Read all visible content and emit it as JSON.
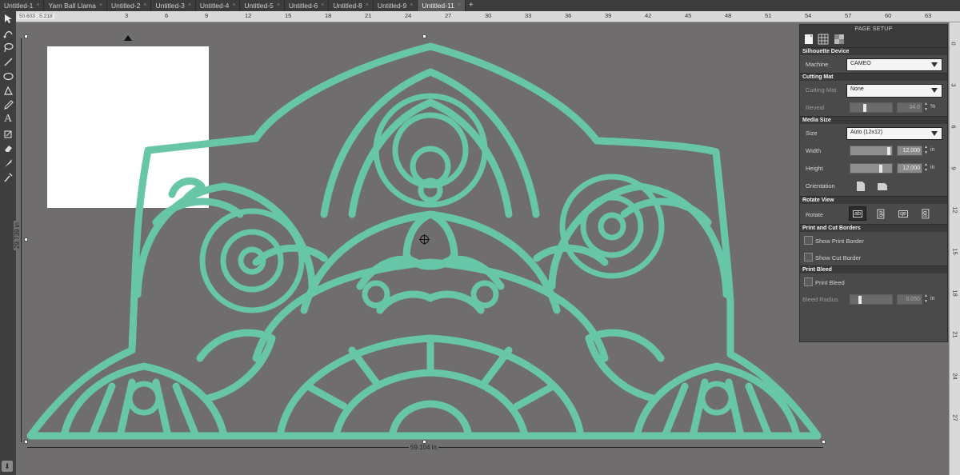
{
  "tabs": [
    {
      "label": "Untitled-1"
    },
    {
      "label": "Yarn Ball Llama"
    },
    {
      "label": "Untitled-2"
    },
    {
      "label": "Untitled-3"
    },
    {
      "label": "Untitled-4"
    },
    {
      "label": "Untitled-5"
    },
    {
      "label": "Untitled-6"
    },
    {
      "label": "Untitled-8"
    },
    {
      "label": "Untitled-9"
    },
    {
      "label": "Untitled-11"
    }
  ],
  "tab_add_label": "+",
  "tab_close_glyph": "×",
  "ruler": {
    "readout": "50.603 , 5.218",
    "top_ticks": [
      "3",
      "6",
      "9",
      "12",
      "15",
      "18",
      "21",
      "24",
      "27",
      "30",
      "33",
      "36",
      "39",
      "42",
      "45",
      "48",
      "51",
      "54",
      "57",
      "60",
      "63",
      "66"
    ],
    "left_ticks": [
      "0",
      "3",
      "6",
      "9",
      "12",
      "15",
      "18",
      "21",
      "24",
      "27"
    ]
  },
  "selection": {
    "width_label": "59.104 in",
    "height_label": "29.739 in"
  },
  "colors": {
    "design": "#68c6a8",
    "canvas": "#6f6d6d",
    "panel": "#4a4a4a"
  },
  "tools": [
    "select-arrow-icon",
    "point-edit-icon",
    "lasso-icon",
    "line-icon",
    "ellipse-icon",
    "polygon-icon",
    "pencil-icon",
    "text-icon",
    "fill-icon",
    "eraser-icon",
    "knife-icon",
    "eyedropper-icon"
  ],
  "panel": {
    "title": "PAGE SETUP",
    "sections": {
      "device": "Silhouette Device",
      "mat": "Cutting Mat",
      "media": "Media Size",
      "rotate": "Rotate View",
      "borders": "Print and Cut Borders",
      "bleed": "Print Bleed"
    },
    "machine": {
      "label": "Machine",
      "value": "CAMEO"
    },
    "cutting_mat": {
      "label": "Cutting Mat",
      "value": "None"
    },
    "reveal": {
      "label": "Reveal",
      "value": "34.0",
      "unit": "%",
      "fraction": 0.34
    },
    "size": {
      "label": "Size",
      "value": "Auto (12x12)"
    },
    "width": {
      "label": "Width",
      "value": "12.000",
      "unit": "in",
      "fraction": 0.96
    },
    "height": {
      "label": "Height",
      "value": "12.000",
      "unit": "in",
      "fraction": 0.74
    },
    "orientation": {
      "label": "Orientation"
    },
    "rotate": {
      "label": "Rotate",
      "options": [
        "ab",
        "ab",
        "qe",
        "ab"
      ]
    },
    "show_print_border": {
      "label": "Show Print Border",
      "checked": false
    },
    "show_cut_border": {
      "label": "Show Cut Border",
      "checked": false
    },
    "print_bleed": {
      "label": "Print Bleed",
      "checked": false
    },
    "bleed_radius": {
      "label": "Bleed Radius",
      "value": "0.050",
      "unit": "in",
      "fraction": 0.2
    }
  }
}
